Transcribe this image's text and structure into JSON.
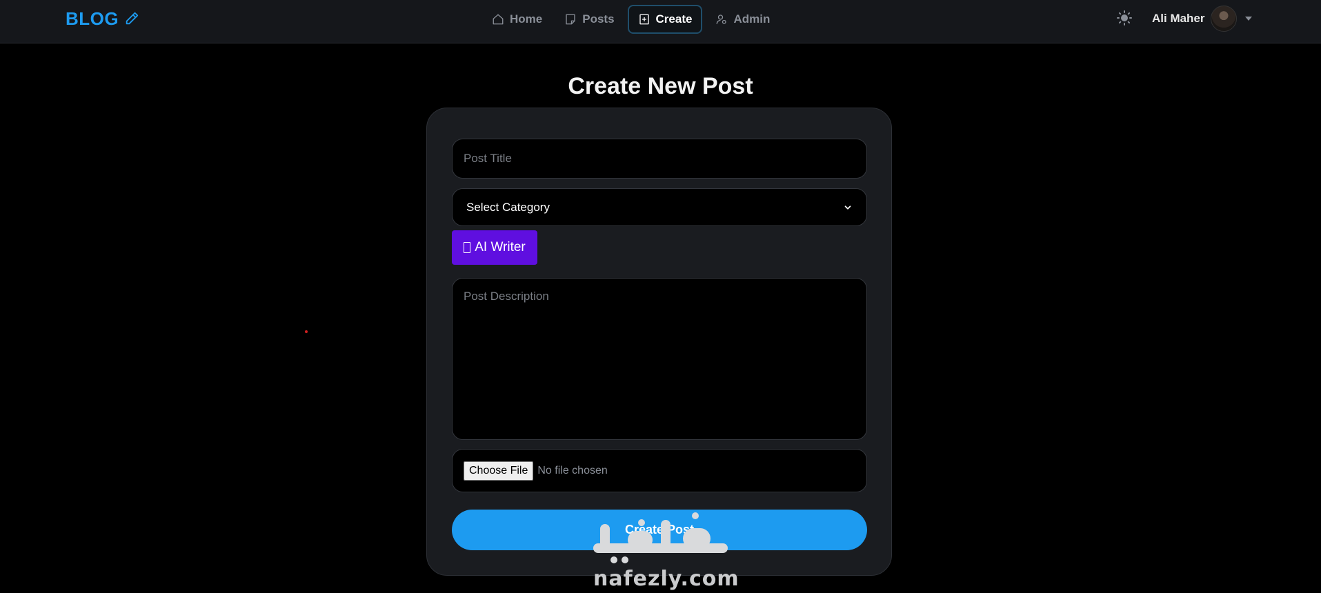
{
  "brand": {
    "name": "BLOG",
    "icon": "pencil-icon",
    "color": "#1d9bf0"
  },
  "nav": {
    "items": [
      {
        "label": "Home",
        "icon": "home-icon",
        "active": false
      },
      {
        "label": "Posts",
        "icon": "posts-icon",
        "active": false
      },
      {
        "label": "Create",
        "icon": "create-icon",
        "active": true
      },
      {
        "label": "Admin",
        "icon": "admin-icon",
        "active": false
      }
    ]
  },
  "header": {
    "theme_icon": "sun-icon",
    "user_name": "Ali Maher"
  },
  "page": {
    "title": "Create New Post"
  },
  "form": {
    "title_placeholder": "Post Title",
    "category_selected": "Select Category",
    "ai_button_label": "AI Writer",
    "description_placeholder": "Post Description",
    "choose_file_label": "Choose File",
    "file_status": "No file chosen",
    "submit_label": "Create Post"
  },
  "watermark": {
    "text": "nafezly.com",
    "arabic": "نفذلي"
  },
  "colors": {
    "accent": "#1d9bf0",
    "ai_button": "#5f0fe0",
    "background": "#000000",
    "card": "#1a1c20"
  }
}
